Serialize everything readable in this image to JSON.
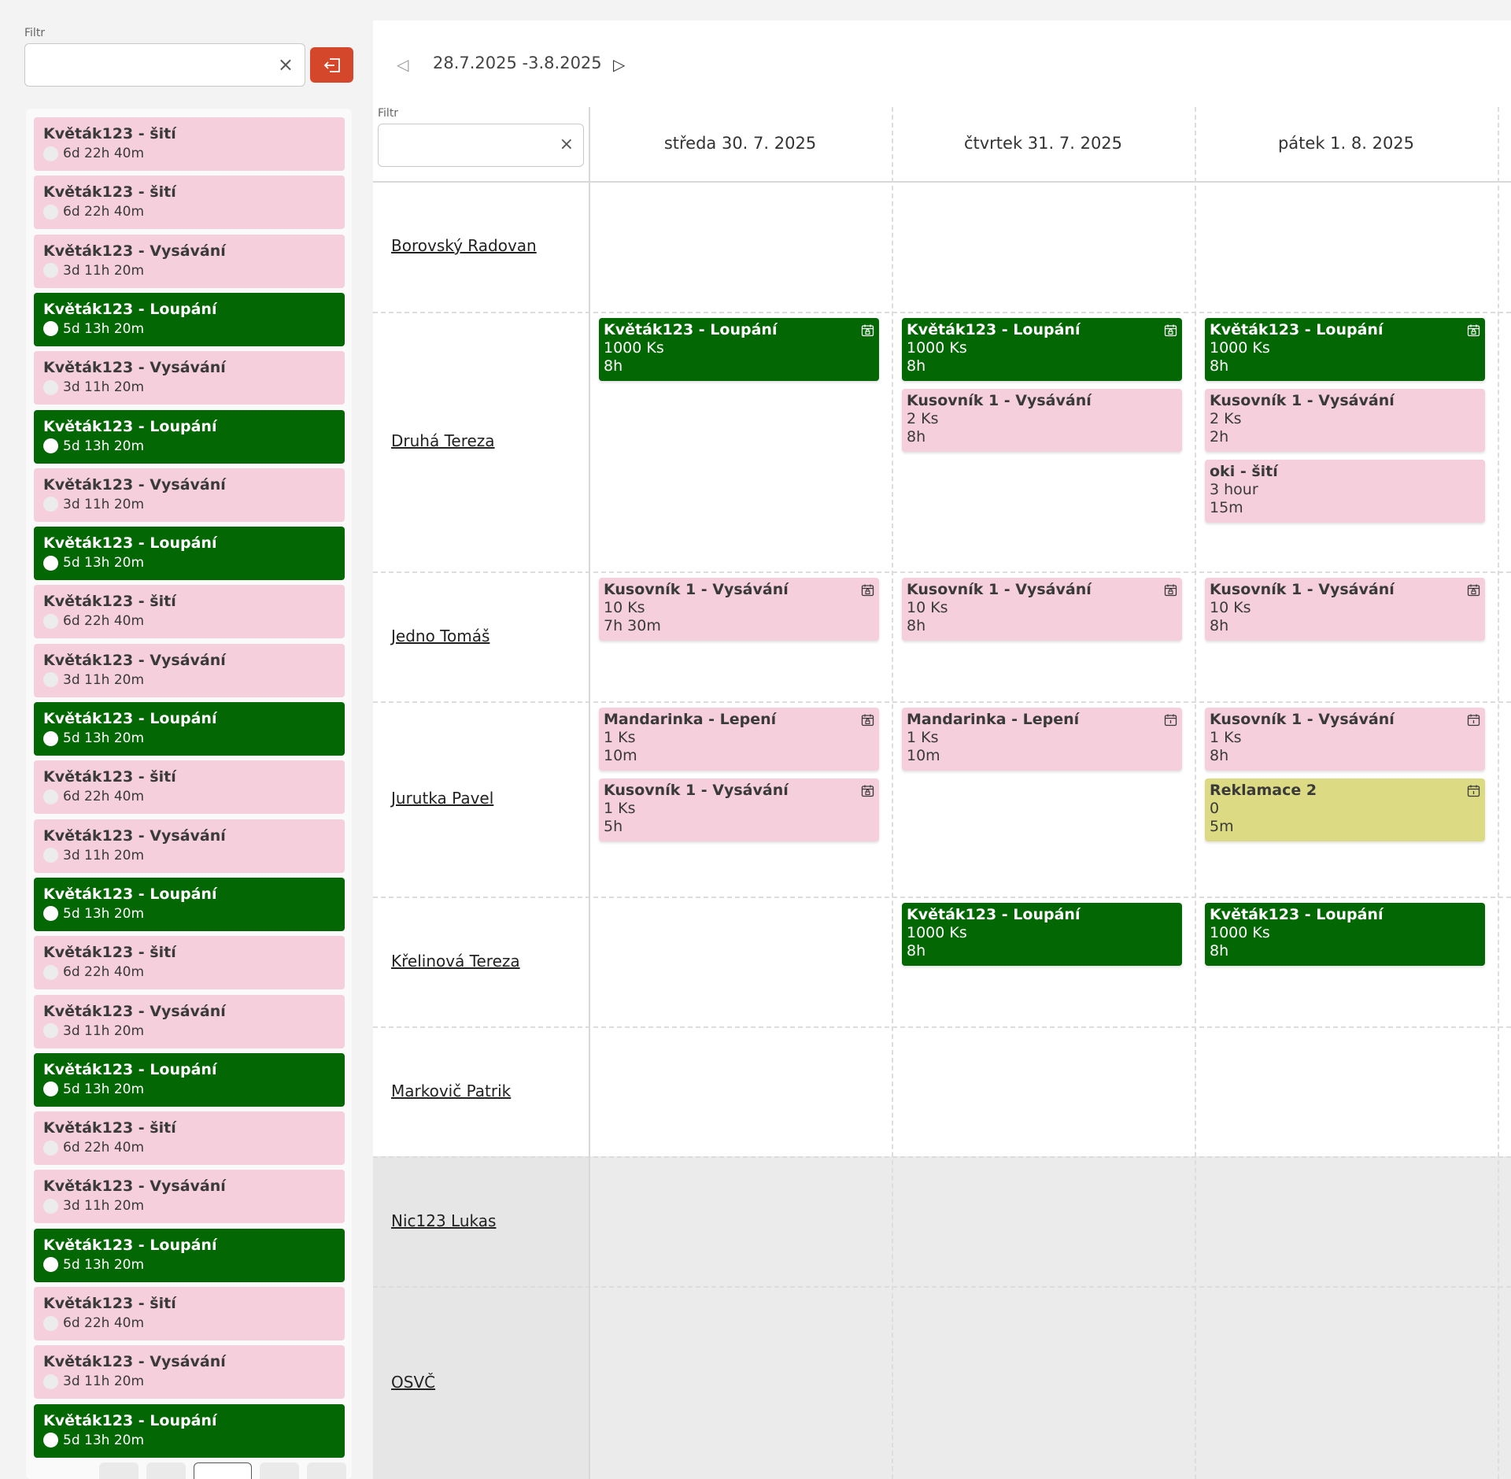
{
  "sidebar": {
    "filter_label": "Filtr",
    "filter_value": "",
    "clear_icon": "×",
    "items": [
      {
        "title": "Květák123 - šití",
        "duration": "6d 22h 40m",
        "status": "pending"
      },
      {
        "title": "Květák123 - šití",
        "duration": "6d 22h 40m",
        "status": "pending"
      },
      {
        "title": "Květák123 - Vysávání",
        "duration": "3d 11h 20m",
        "status": "pending"
      },
      {
        "title": "Květák123 - Loupání",
        "duration": "5d 13h 20m",
        "status": "active"
      },
      {
        "title": "Květák123 - Vysávání",
        "duration": "3d 11h 20m",
        "status": "pending"
      },
      {
        "title": "Květák123 - Loupání",
        "duration": "5d 13h 20m",
        "status": "active"
      },
      {
        "title": "Květák123 - Vysávání",
        "duration": "3d 11h 20m",
        "status": "pending"
      },
      {
        "title": "Květák123 - Loupání",
        "duration": "5d 13h 20m",
        "status": "active"
      },
      {
        "title": "Květák123 - šití",
        "duration": "6d 22h 40m",
        "status": "pending"
      },
      {
        "title": "Květák123 - Vysávání",
        "duration": "3d 11h 20m",
        "status": "pending"
      },
      {
        "title": "Květák123 - Loupání",
        "duration": "5d 13h 20m",
        "status": "active"
      },
      {
        "title": "Květák123 - šití",
        "duration": "6d 22h 40m",
        "status": "pending"
      },
      {
        "title": "Květák123 - Vysávání",
        "duration": "3d 11h 20m",
        "status": "pending"
      },
      {
        "title": "Květák123 - Loupání",
        "duration": "5d 13h 20m",
        "status": "active"
      },
      {
        "title": "Květák123 - šití",
        "duration": "6d 22h 40m",
        "status": "pending"
      },
      {
        "title": "Květák123 - Vysávání",
        "duration": "3d 11h 20m",
        "status": "pending"
      },
      {
        "title": "Květák123 - Loupání",
        "duration": "5d 13h 20m",
        "status": "active"
      },
      {
        "title": "Květák123 - šití",
        "duration": "6d 22h 40m",
        "status": "pending"
      },
      {
        "title": "Květák123 - Vysávání",
        "duration": "3d 11h 20m",
        "status": "pending"
      },
      {
        "title": "Květák123 - Loupání",
        "duration": "5d 13h 20m",
        "status": "active"
      },
      {
        "title": "Květák123 - šití",
        "duration": "6d 22h 40m",
        "status": "pending"
      },
      {
        "title": "Květák123 - Vysávání",
        "duration": "3d 11h 20m",
        "status": "pending"
      },
      {
        "title": "Květák123 - Loupání",
        "duration": "5d 13h 20m",
        "status": "active"
      }
    ]
  },
  "colors": {
    "active": "#036803",
    "pending": "#f5cfdc",
    "complaint": "#dcdb84",
    "exit_button": "#d4472b"
  },
  "planner": {
    "week_range": "28.7.2025 -3.8.2025",
    "filter_label": "Filtr",
    "filter_value": "",
    "clear_icon": "×",
    "days": [
      "středa 30. 7. 2025",
      "čtvrtek 31. 7. 2025",
      "pátek 1. 8. 2025"
    ],
    "employees": [
      {
        "name": "Borovský Radovan",
        "disabled": false
      },
      {
        "name": "Druhá Tereza",
        "disabled": false
      },
      {
        "name": "Jedno Tomáš",
        "disabled": false
      },
      {
        "name": "Jurutka Pavel",
        "disabled": false
      },
      {
        "name": "Křelinová Tereza",
        "disabled": false
      },
      {
        "name": "Markovič Patrik",
        "disabled": false
      },
      {
        "name": "Nic123 Lukas",
        "disabled": true
      },
      {
        "name": "OSVČ",
        "disabled": true
      }
    ],
    "tasks": [
      {
        "row": 1,
        "day": 0,
        "slot": 0,
        "kind": "green",
        "icon": "calendar-lock-icon",
        "lines": [
          "Květák123 - Loupání",
          "1000 Ks",
          "8h"
        ]
      },
      {
        "row": 1,
        "day": 1,
        "slot": 0,
        "kind": "green",
        "icon": "calendar-lock-icon",
        "lines": [
          "Květák123 - Loupání",
          "1000 Ks",
          "8h"
        ]
      },
      {
        "row": 1,
        "day": 1,
        "slot": 1,
        "kind": "pink",
        "icon": null,
        "lines": [
          "Kusovník 1 - Vysávání",
          "2 Ks",
          "8h"
        ]
      },
      {
        "row": 1,
        "day": 2,
        "slot": 0,
        "kind": "green",
        "icon": "calendar-lock-icon",
        "lines": [
          "Květák123 - Loupání",
          "1000 Ks",
          "8h"
        ]
      },
      {
        "row": 1,
        "day": 2,
        "slot": 1,
        "kind": "pink",
        "icon": null,
        "lines": [
          "Kusovník 1 - Vysávání",
          "2 Ks",
          "2h"
        ]
      },
      {
        "row": 1,
        "day": 2,
        "slot": 2,
        "kind": "pink",
        "icon": null,
        "lines": [
          "oki - šití",
          "3 hour",
          "15m"
        ]
      },
      {
        "row": 2,
        "day": 0,
        "slot": 0,
        "kind": "pink",
        "icon": "calendar-lock-icon",
        "lines": [
          "Kusovník 1 - Vysávání",
          "10 Ks",
          "7h 30m"
        ]
      },
      {
        "row": 2,
        "day": 1,
        "slot": 0,
        "kind": "pink",
        "icon": "calendar-lock-icon",
        "lines": [
          "Kusovník 1 - Vysávání",
          "10 Ks",
          "8h"
        ]
      },
      {
        "row": 2,
        "day": 2,
        "slot": 0,
        "kind": "pink",
        "icon": "calendar-lock-icon",
        "lines": [
          "Kusovník 1 - Vysávání",
          "10 Ks",
          "8h"
        ]
      },
      {
        "row": 3,
        "day": 0,
        "slot": 0,
        "kind": "pink",
        "icon": "calendar-lock-icon",
        "lines": [
          "Mandarinka - Lepení",
          "1 Ks",
          "10m"
        ]
      },
      {
        "row": 3,
        "day": 0,
        "slot": 1,
        "kind": "pink",
        "icon": "calendar-lock-icon",
        "lines": [
          "Kusovník 1 - Vysávání",
          "1 Ks",
          "5h"
        ]
      },
      {
        "row": 3,
        "day": 1,
        "slot": 0,
        "kind": "pink",
        "icon": "calendar-icon",
        "lines": [
          "Mandarinka - Lepení",
          "1 Ks",
          "10m"
        ]
      },
      {
        "row": 3,
        "day": 2,
        "slot": 0,
        "kind": "pink",
        "icon": "calendar-icon",
        "lines": [
          "Kusovník 1 - Vysávání",
          "1 Ks",
          "8h"
        ]
      },
      {
        "row": 3,
        "day": 2,
        "slot": 1,
        "kind": "yellow",
        "icon": "calendar-icon",
        "lines": [
          "Reklamace 2",
          "0",
          "5m"
        ]
      },
      {
        "row": 4,
        "day": 1,
        "slot": 0,
        "kind": "green",
        "icon": null,
        "lines": [
          "Květák123 - Loupání",
          "1000 Ks",
          "8h"
        ]
      },
      {
        "row": 4,
        "day": 2,
        "slot": 0,
        "kind": "green",
        "icon": null,
        "lines": [
          "Květák123 - Loupání",
          "1000 Ks",
          "8h"
        ]
      }
    ]
  }
}
